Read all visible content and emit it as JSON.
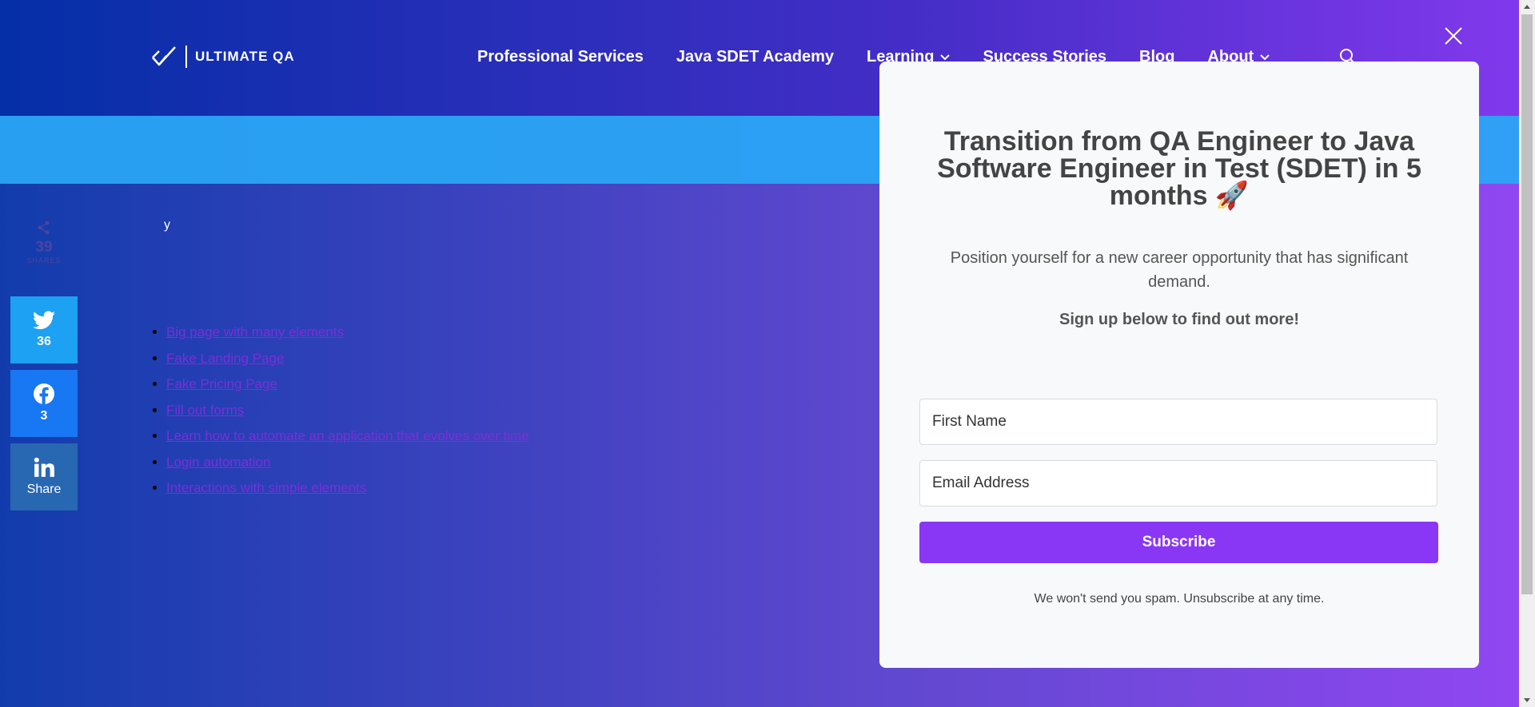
{
  "header": {
    "logo_text": "ULTIMATE QA",
    "nav": [
      {
        "label": "Professional Services",
        "has_dropdown": false
      },
      {
        "label": "Java SDET Academy",
        "has_dropdown": false
      },
      {
        "label": "Learning",
        "has_dropdown": true
      },
      {
        "label": "Success Stories",
        "has_dropdown": false
      },
      {
        "label": "Blog",
        "has_dropdown": false
      },
      {
        "label": "About",
        "has_dropdown": true
      }
    ],
    "search_icon": "search-icon"
  },
  "banner": {
    "text": "y"
  },
  "share": {
    "total": "39",
    "total_label": "SHARES",
    "twitter_count": "36",
    "facebook_count": "3",
    "linkedin_label": "Share"
  },
  "links": [
    "Big page with many elements",
    "Fake Landing Page",
    "Fake Pricing Page",
    "Fill out forms",
    "Learn how to automate an application that evolves over time",
    "Login automation",
    "Interactions with simple elements"
  ],
  "modal": {
    "title": "Transition from QA Engineer to Java Software Engineer in Test (SDET) in 5 months 🚀",
    "subtitle": "Position yourself for a new career opportunity that has significant demand.",
    "cta": "Sign up below to find out more!",
    "first_name_placeholder": "First Name",
    "email_placeholder": "Email Address",
    "subscribe_label": "Subscribe",
    "fine_print": "We won't send you spam. Unsubscribe at any time."
  },
  "colors": {
    "overlay_start": "#0a3a9e",
    "overlay_end": "#8a38f2",
    "banner_blue": "#2ba5f5",
    "button_purple": "#8a36f5",
    "twitter": "#1da1f2",
    "facebook": "#1877f2",
    "linkedin": "#2867b2"
  }
}
